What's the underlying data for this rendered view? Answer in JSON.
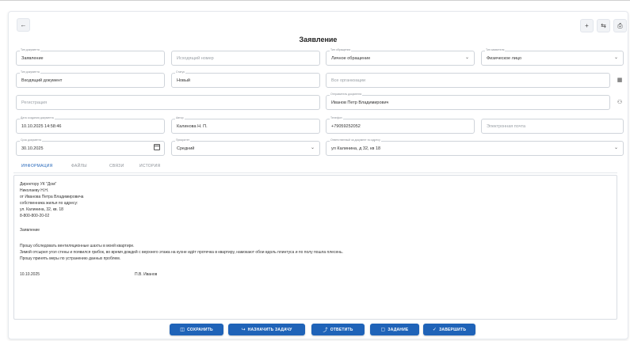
{
  "window": {
    "title": "Заявление",
    "back_icon": "arrow-left-icon",
    "toolbar_icons": [
      "add-icon",
      "link-icon",
      "print-icon"
    ],
    "toolbar_glyphs": [
      "+",
      "⇆",
      "⎙"
    ]
  },
  "fields": {
    "doc_type": {
      "label": "Тип документа",
      "value": "Заявление"
    },
    "outgoing_number": {
      "label": "",
      "placeholder": "Исходящий номер"
    },
    "appeal_type": {
      "label": "Тип обращения",
      "value": "Личное обращение"
    },
    "applicant_type": {
      "label": "Тип заявителя",
      "value": "Физическое лицо"
    },
    "doc_kind": {
      "label": "Тип документа",
      "value": "Входящий документ"
    },
    "status": {
      "label": "Статус",
      "value": "Новый"
    },
    "organization": {
      "label": "",
      "placeholder": "Все организации"
    },
    "registration": {
      "label": "",
      "placeholder": "Регистрация"
    },
    "sender": {
      "label": "Отправитель документа",
      "value": "Иванов Петр Владимирович"
    },
    "created_at": {
      "label": "Дата создания документа",
      "value": "10.10.2025 14:58:46"
    },
    "author": {
      "label": "Автор",
      "value": "Калинова Н. П."
    },
    "phone": {
      "label": "Телефон",
      "value": "+79059252052"
    },
    "email": {
      "label": "",
      "placeholder": "Электронная почта"
    },
    "due_date": {
      "label": "Срок документа",
      "value": "30.10.2025"
    },
    "priority": {
      "label": "Приоритет",
      "value": "Средний"
    },
    "address": {
      "label": "Ответственный за документ по адресу",
      "value": "ул Калинина, д 32, кв 18"
    }
  },
  "tabs": [
    "ИНФОРМАЦИЯ",
    "ФАЙЛЫ",
    "СВЯЗИ",
    "ИСТОРИЯ"
  ],
  "active_tab": "ИНФОРМАЦИЯ",
  "editor_lines": [
    "Директору УК \"Дом\"",
    "Николаеву Н.Н.",
    "от Иванова Петра Владимировича",
    "собственника жилья по адресу:",
    "ул. Калинина, 32, кв. 18",
    "8-800-800-20-02",
    "",
    "Заявление",
    "",
    "Прошу обследовать вентиляционные шахты в моей квартире.",
    "Зимой отсырел угол стены и появился грибок, во время дождей с верхнего этажа на кухне идёт протечка в квартиру, намокают обои вдоль плинтуса и по полу пошла плесень.",
    "Прошу принять меры по устранению данных проблем."
  ],
  "editor_footer": {
    "date": "10.10.2025",
    "signature": "П.В. Иванов"
  },
  "buttons": [
    {
      "label": "СОХРАНИТЬ",
      "icon": "save-icon",
      "glyph": "◫"
    },
    {
      "label": "НАЗНАЧИТЬ ЗАДАЧУ",
      "icon": "assign-icon",
      "glyph": "↪"
    },
    {
      "label": "ОТВЕТИТЬ",
      "icon": "reply-icon",
      "glyph": "⤴"
    },
    {
      "label": "ЗАДАНИЕ",
      "icon": "task-icon",
      "glyph": "▢"
    },
    {
      "label": "ЗАВЕРШИТЬ",
      "icon": "check-icon",
      "glyph": "✓"
    }
  ],
  "colors": {
    "accent": "#1f63b8",
    "border": "#cfd4da",
    "muted": "#8a8f96"
  }
}
